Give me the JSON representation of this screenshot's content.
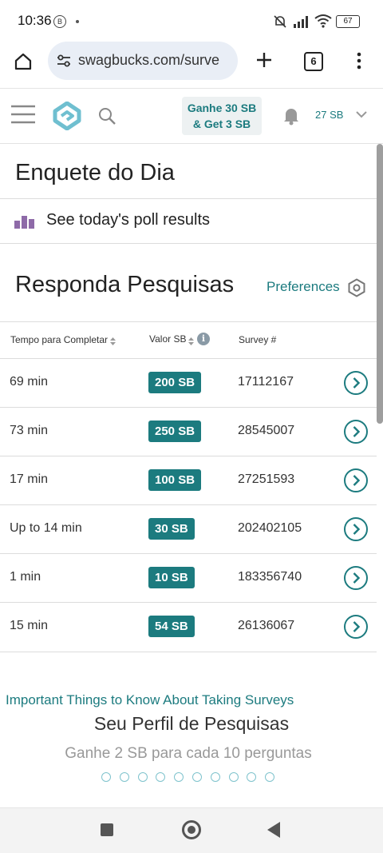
{
  "status_bar": {
    "time": "10:36",
    "notification_badge": "B",
    "battery": "67"
  },
  "browser": {
    "url": "swagbucks.com/surve",
    "tab_count": "6"
  },
  "site_header": {
    "earn_line1": "Ganhe 30 SB",
    "earn_line2": "& Get 3 SB",
    "sb_balance": "27 SB"
  },
  "poll": {
    "title": "Enquete do Dia",
    "link_label": "See today's poll results"
  },
  "surveys": {
    "title": "Responda Pesquisas",
    "preferences_label": "Preferences",
    "columns": [
      "Tempo para Completar",
      "Valor SB",
      "Survey #"
    ],
    "rows": [
      {
        "time": "69 min",
        "value": "200 SB",
        "id": "17112167"
      },
      {
        "time": "73 min",
        "value": "250 SB",
        "id": "28545007"
      },
      {
        "time": "17 min",
        "value": "100 SB",
        "id": "27251593"
      },
      {
        "time": "Up to 14 min",
        "value": "30 SB",
        "id": "202402105"
      },
      {
        "time": "1 min",
        "value": "10 SB",
        "id": "183356740"
      },
      {
        "time": "15 min",
        "value": "54 SB",
        "id": "26136067"
      }
    ]
  },
  "footer": {
    "important_link": "Important Things to Know About Taking Surveys",
    "profile_title": "Seu Perfil de Pesquisas",
    "profile_subtitle": "Ganhe 2 SB para cada 10 perguntas",
    "carousel_dot_count": 10
  },
  "colors": {
    "accent": "#1c7b7f",
    "badge_bg": "#1c7b7f",
    "logo": "#6fbfd0",
    "poll_icon": "#8e6aa8"
  }
}
